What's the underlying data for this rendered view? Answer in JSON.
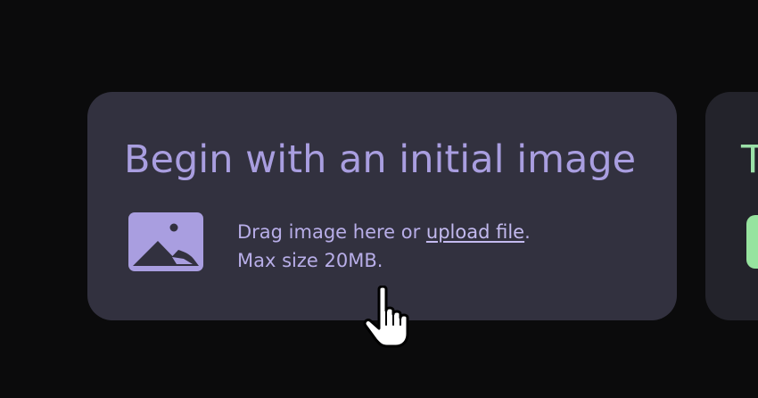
{
  "card": {
    "title": "Begin with an initial image",
    "drop_prefix": "Drag image here or ",
    "upload_link": "upload file",
    "drop_suffix": ".",
    "max_size": "Max size 20MB.",
    "icon": "image-icon"
  },
  "next_card": {
    "title_partial": "T",
    "button_color": "#97e39f"
  },
  "colors": {
    "background": "#0b0b0c",
    "card": "#32313f",
    "accent": "#a99ee0",
    "next_accent": "#9be0a8"
  },
  "cursor": "hand-pointer-cursor"
}
